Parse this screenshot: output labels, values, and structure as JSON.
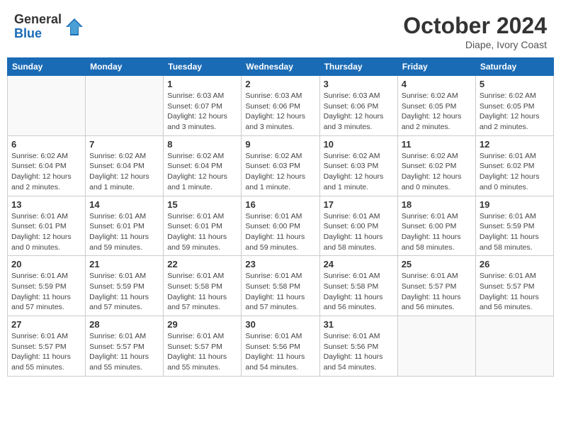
{
  "logo": {
    "general": "General",
    "blue": "Blue"
  },
  "title": "October 2024",
  "location": "Diape, Ivory Coast",
  "days_of_week": [
    "Sunday",
    "Monday",
    "Tuesday",
    "Wednesday",
    "Thursday",
    "Friday",
    "Saturday"
  ],
  "weeks": [
    [
      {
        "day": "",
        "info": ""
      },
      {
        "day": "",
        "info": ""
      },
      {
        "day": "1",
        "info": "Sunrise: 6:03 AM\nSunset: 6:07 PM\nDaylight: 12 hours and 3 minutes."
      },
      {
        "day": "2",
        "info": "Sunrise: 6:03 AM\nSunset: 6:06 PM\nDaylight: 12 hours and 3 minutes."
      },
      {
        "day": "3",
        "info": "Sunrise: 6:03 AM\nSunset: 6:06 PM\nDaylight: 12 hours and 3 minutes."
      },
      {
        "day": "4",
        "info": "Sunrise: 6:02 AM\nSunset: 6:05 PM\nDaylight: 12 hours and 2 minutes."
      },
      {
        "day": "5",
        "info": "Sunrise: 6:02 AM\nSunset: 6:05 PM\nDaylight: 12 hours and 2 minutes."
      }
    ],
    [
      {
        "day": "6",
        "info": "Sunrise: 6:02 AM\nSunset: 6:04 PM\nDaylight: 12 hours and 2 minutes."
      },
      {
        "day": "7",
        "info": "Sunrise: 6:02 AM\nSunset: 6:04 PM\nDaylight: 12 hours and 1 minute."
      },
      {
        "day": "8",
        "info": "Sunrise: 6:02 AM\nSunset: 6:04 PM\nDaylight: 12 hours and 1 minute."
      },
      {
        "day": "9",
        "info": "Sunrise: 6:02 AM\nSunset: 6:03 PM\nDaylight: 12 hours and 1 minute."
      },
      {
        "day": "10",
        "info": "Sunrise: 6:02 AM\nSunset: 6:03 PM\nDaylight: 12 hours and 1 minute."
      },
      {
        "day": "11",
        "info": "Sunrise: 6:02 AM\nSunset: 6:02 PM\nDaylight: 12 hours and 0 minutes."
      },
      {
        "day": "12",
        "info": "Sunrise: 6:01 AM\nSunset: 6:02 PM\nDaylight: 12 hours and 0 minutes."
      }
    ],
    [
      {
        "day": "13",
        "info": "Sunrise: 6:01 AM\nSunset: 6:01 PM\nDaylight: 12 hours and 0 minutes."
      },
      {
        "day": "14",
        "info": "Sunrise: 6:01 AM\nSunset: 6:01 PM\nDaylight: 11 hours and 59 minutes."
      },
      {
        "day": "15",
        "info": "Sunrise: 6:01 AM\nSunset: 6:01 PM\nDaylight: 11 hours and 59 minutes."
      },
      {
        "day": "16",
        "info": "Sunrise: 6:01 AM\nSunset: 6:00 PM\nDaylight: 11 hours and 59 minutes."
      },
      {
        "day": "17",
        "info": "Sunrise: 6:01 AM\nSunset: 6:00 PM\nDaylight: 11 hours and 58 minutes."
      },
      {
        "day": "18",
        "info": "Sunrise: 6:01 AM\nSunset: 6:00 PM\nDaylight: 11 hours and 58 minutes."
      },
      {
        "day": "19",
        "info": "Sunrise: 6:01 AM\nSunset: 5:59 PM\nDaylight: 11 hours and 58 minutes."
      }
    ],
    [
      {
        "day": "20",
        "info": "Sunrise: 6:01 AM\nSunset: 5:59 PM\nDaylight: 11 hours and 57 minutes."
      },
      {
        "day": "21",
        "info": "Sunrise: 6:01 AM\nSunset: 5:59 PM\nDaylight: 11 hours and 57 minutes."
      },
      {
        "day": "22",
        "info": "Sunrise: 6:01 AM\nSunset: 5:58 PM\nDaylight: 11 hours and 57 minutes."
      },
      {
        "day": "23",
        "info": "Sunrise: 6:01 AM\nSunset: 5:58 PM\nDaylight: 11 hours and 57 minutes."
      },
      {
        "day": "24",
        "info": "Sunrise: 6:01 AM\nSunset: 5:58 PM\nDaylight: 11 hours and 56 minutes."
      },
      {
        "day": "25",
        "info": "Sunrise: 6:01 AM\nSunset: 5:57 PM\nDaylight: 11 hours and 56 minutes."
      },
      {
        "day": "26",
        "info": "Sunrise: 6:01 AM\nSunset: 5:57 PM\nDaylight: 11 hours and 56 minutes."
      }
    ],
    [
      {
        "day": "27",
        "info": "Sunrise: 6:01 AM\nSunset: 5:57 PM\nDaylight: 11 hours and 55 minutes."
      },
      {
        "day": "28",
        "info": "Sunrise: 6:01 AM\nSunset: 5:57 PM\nDaylight: 11 hours and 55 minutes."
      },
      {
        "day": "29",
        "info": "Sunrise: 6:01 AM\nSunset: 5:57 PM\nDaylight: 11 hours and 55 minutes."
      },
      {
        "day": "30",
        "info": "Sunrise: 6:01 AM\nSunset: 5:56 PM\nDaylight: 11 hours and 54 minutes."
      },
      {
        "day": "31",
        "info": "Sunrise: 6:01 AM\nSunset: 5:56 PM\nDaylight: 11 hours and 54 minutes."
      },
      {
        "day": "",
        "info": ""
      },
      {
        "day": "",
        "info": ""
      }
    ]
  ]
}
